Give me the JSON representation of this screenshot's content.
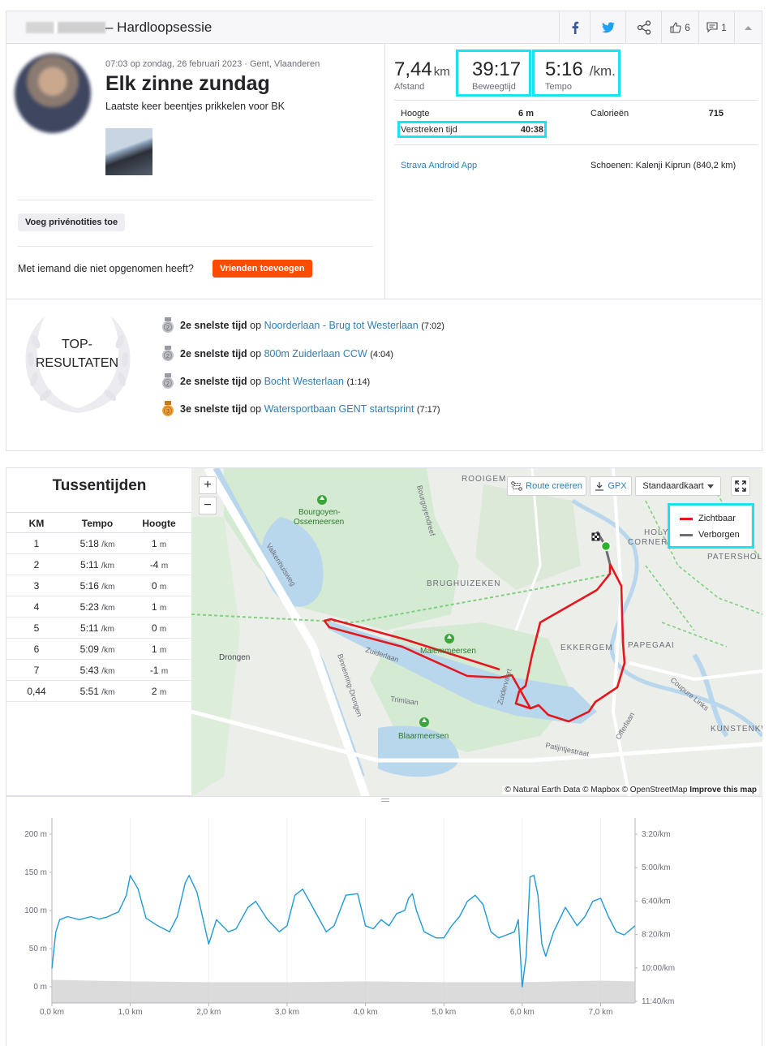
{
  "header": {
    "title": "– Hardloopsessie",
    "likes_count": "6",
    "comments_count": "1"
  },
  "activity": {
    "meta": "07:03 op zondag, 26 februari 2023 · Gent, Vlaanderen",
    "title": "Elk zinne zundag",
    "description": "Laatste keer beentjes prikkelen voor BK",
    "private_notes_button": "Voeg privénotities toe",
    "friends_question": "Met iemand die niet opgenomen heeft?",
    "friends_button": "Vrienden toevoegen"
  },
  "stats": {
    "distance": {
      "value": "7,44",
      "unit": "km",
      "label": "Afstand"
    },
    "moving_time": {
      "value": "39:17",
      "label": "Beweegtijd"
    },
    "pace": {
      "value": "5:16",
      "unit": "/km.",
      "label": "Tempo"
    },
    "elevation_label": "Hoogte",
    "elevation_value": "6 m",
    "calories_label": "Calorieën",
    "calories_value": "715",
    "elapsed_label": "Verstreken tijd",
    "elapsed_value": "40:38",
    "device": "Strava Android App",
    "shoes": "Schoenen: Kalenji Kiprun (840,2 km)"
  },
  "achievements": {
    "badge_text_1": "TOP-",
    "badge_text_2": "RESULTATEN",
    "items": [
      {
        "rank": "2e snelste tijd",
        "op": "op",
        "segment": "Noorderlaan - Brug tot Westerlaan",
        "time": "(7:02)",
        "medal": "silver"
      },
      {
        "rank": "2e snelste tijd",
        "op": "op",
        "segment": "800m Zuiderlaan CCW",
        "time": "(4:04)",
        "medal": "silver"
      },
      {
        "rank": "2e snelste tijd",
        "op": "op",
        "segment": "Bocht Westerlaan",
        "time": "(1:14)",
        "medal": "silver"
      },
      {
        "rank": "3e snelste tijd",
        "op": "op",
        "segment": "Watersportbaan GENT startsprint",
        "time": "(7:17)",
        "medal": "bronze"
      }
    ]
  },
  "splits": {
    "title": "Tussentijden",
    "headers": [
      "KM",
      "Tempo",
      "Hoogte"
    ],
    "pace_unit": "/km",
    "elev_unit": "m",
    "rows": [
      {
        "km": "1",
        "pace": "5:18",
        "elev": "1"
      },
      {
        "km": "2",
        "pace": "5:11",
        "elev": "-4"
      },
      {
        "km": "3",
        "pace": "5:16",
        "elev": "0"
      },
      {
        "km": "4",
        "pace": "5:23",
        "elev": "1"
      },
      {
        "km": "5",
        "pace": "5:11",
        "elev": "0"
      },
      {
        "km": "6",
        "pace": "5:09",
        "elev": "1"
      },
      {
        "km": "7",
        "pace": "5:43",
        "elev": "-1"
      },
      {
        "km": "0,44",
        "pace": "5:51",
        "elev": "2"
      }
    ]
  },
  "map": {
    "zoom_in": "+",
    "zoom_out": "−",
    "route_button": "Route creëren",
    "gpx_button": "GPX",
    "style_select": "Standaardkaart",
    "legend_visible": "Zichtbaar",
    "legend_hidden": "Verborgen",
    "legend_visible_color": "#e4171d",
    "legend_hidden_color": "#6d6d78",
    "attribution": "© Natural Earth Data © Mapbox © OpenStreetMap",
    "attribution_link": "Improve this map",
    "labels": {
      "rooigem": "ROOIGEM",
      "bourgoyen1": "Bourgoyen-",
      "bourgoyen2": "Ossemeersen",
      "brughuizeken": "BRUGHUIZEKEN",
      "holy1": "HOLY",
      "holy2": "CORNER",
      "patershol": "PATERSHOL",
      "malem": "Malemmeersen",
      "ekkergem": "EKKERGEM",
      "papegaai": "PAPEGAAI",
      "drongen": "Drongen",
      "zuiderlaan": "Zuiderlaan",
      "trimlaan": "Trimlaan",
      "blaarmeersen": "Blaarmeersen",
      "kunstenkw": "KUNSTENKW",
      "coupure": "Coupure Links",
      "offerlaan": "Offerlaan",
      "patijntje": "Patijntjestraat",
      "binnenring": "Binnenring-Drongen",
      "valkenhuis": "Valkenhuisweg",
      "bourgoyen_dreef": "Bourgoyendreef",
      "ekkergemstr": "Zuidervaart"
    }
  },
  "chart_data": {
    "type": "line",
    "x_unit": "km",
    "xlim": [
      0,
      7.44
    ],
    "x_ticks": [
      "0,0 km",
      "1,0 km",
      "2,0 km",
      "3,0 km",
      "4,0 km",
      "5,0 km",
      "6,0 km",
      "7,0 km"
    ],
    "y_left_ticks": [
      "200 m",
      "150 m",
      "100 m",
      "50 m",
      "0 m"
    ],
    "y_right_ticks": [
      "3:20/km",
      "5:00/km",
      "6:40/km",
      "8:20/km",
      "10:00/km",
      "11:40/km"
    ],
    "ylim_left": [
      0,
      200
    ],
    "ylim_right_sec_per_km": [
      200,
      700
    ],
    "pace_color": "#1e9ad6",
    "elevation_color": "#cccccc",
    "series": [
      {
        "type": "line",
        "axis": "right",
        "x": [
          0.0,
          0.05,
          0.1,
          0.2,
          0.35,
          0.5,
          0.6,
          0.7,
          0.8,
          0.85,
          0.95,
          1.0,
          1.1,
          1.2,
          1.35,
          1.5,
          1.6,
          1.7,
          1.75,
          1.85,
          2.0,
          2.1,
          2.25,
          2.35,
          2.5,
          2.6,
          2.75,
          2.9,
          3.0,
          3.1,
          3.2,
          3.35,
          3.5,
          3.6,
          3.75,
          3.9,
          4.0,
          4.1,
          4.2,
          4.3,
          4.4,
          4.5,
          4.55,
          4.6,
          4.65,
          4.75,
          4.9,
          5.0,
          5.1,
          5.2,
          5.3,
          5.4,
          5.5,
          5.6,
          5.7,
          5.8,
          5.9,
          5.95,
          6.0,
          6.05,
          6.1,
          6.15,
          6.2,
          6.25,
          6.3,
          6.4,
          6.55,
          6.7,
          6.8,
          6.9,
          7.0,
          7.1,
          7.2,
          7.3,
          7.44
        ],
        "y": [
          640,
          520,
          480,
          470,
          480,
          470,
          478,
          472,
          460,
          455,
          400,
          335,
          380,
          475,
          500,
          520,
          470,
          360,
          335,
          390,
          560,
          480,
          520,
          510,
          440,
          420,
          480,
          520,
          500,
          400,
          380,
          450,
          520,
          500,
          400,
          395,
          500,
          510,
          480,
          500,
          460,
          450,
          410,
          395,
          450,
          520,
          540,
          540,
          500,
          470,
          420,
          400,
          430,
          520,
          540,
          530,
          520,
          480,
          700,
          600,
          340,
          335,
          400,
          560,
          600,
          520,
          440,
          500,
          470,
          420,
          410,
          470,
          520,
          530,
          500
        ]
      },
      {
        "type": "area",
        "axis": "left",
        "x": [
          0.0,
          1.0,
          2.0,
          3.0,
          4.0,
          5.0,
          6.0,
          7.0,
          7.44
        ],
        "y": [
          9,
          7,
          6,
          6,
          7,
          6,
          6,
          8,
          7
        ]
      }
    ]
  }
}
